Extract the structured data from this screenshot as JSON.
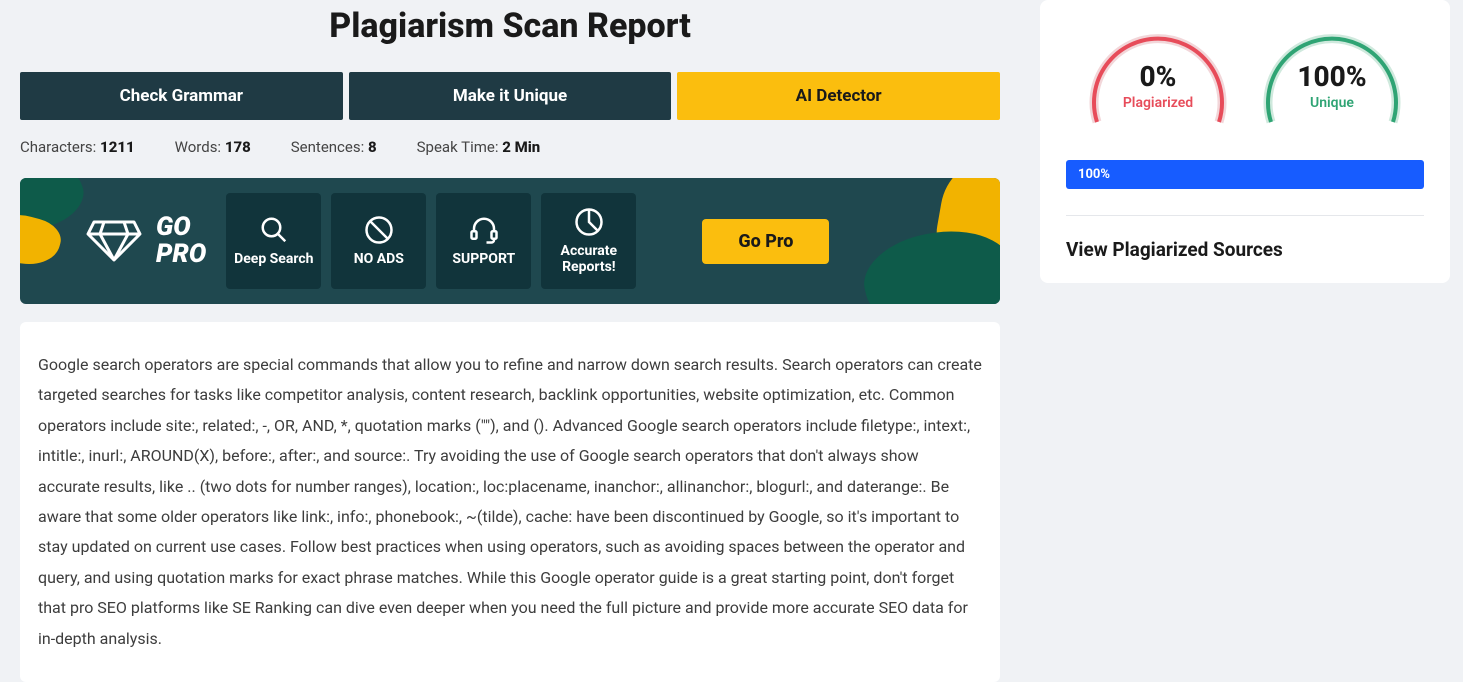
{
  "page": {
    "title": "Plagiarism Scan Report"
  },
  "actions": {
    "check_grammar": "Check Grammar",
    "make_unique": "Make it Unique",
    "ai_detector": "AI Detector"
  },
  "stats": {
    "characters_label": "Characters:",
    "characters_value": "1211",
    "words_label": "Words:",
    "words_value": "178",
    "sentences_label": "Sentences:",
    "sentences_value": "8",
    "speak_label": "Speak Time:",
    "speak_value": "2 Min"
  },
  "gopro": {
    "brand_line1": "GO",
    "brand_line2": "PRO",
    "features": {
      "deep_search": "Deep Search",
      "no_ads": "NO ADS",
      "support": "SUPPORT",
      "reports": "Accurate Reports!"
    },
    "button": "Go Pro"
  },
  "content": {
    "body": "Google search operators are special commands that allow you to refine and narrow down search results. Search operators can create targeted searches for tasks like competitor analysis, content research, backlink opportunities, website optimization, etc. Common operators include site:, related:, -, OR, AND, *, quotation marks (\"\"), and (). Advanced Google search operators include filetype:, intext:, intitle:, inurl:, AROUND(X), before:, after:, and source:. Try avoiding the use of Google search operators that don't always show accurate results, like .. (two dots for number ranges), location:, loc:placename, inanchor:, allinanchor:, blogurl:, and daterange:. Be aware that some older operators like link:, info:, phonebook:, ~(tilde), cache: have been discontinued by Google, so it's important to stay updated on current use cases. Follow best practices when using operators, such as avoiding spaces between the operator and query, and using quotation marks for exact phrase matches. While this Google operator guide is a great starting point, don't forget that pro SEO platforms like SE Ranking can dive even deeper when you need the full picture and provide more accurate SEO data for in-depth analysis."
  },
  "results": {
    "plagiarized_pct": "0%",
    "plagiarized_label": "Plagiarized",
    "unique_pct": "100%",
    "unique_label": "Unique",
    "progress": "100%",
    "view_sources": "View Plagiarized Sources"
  }
}
